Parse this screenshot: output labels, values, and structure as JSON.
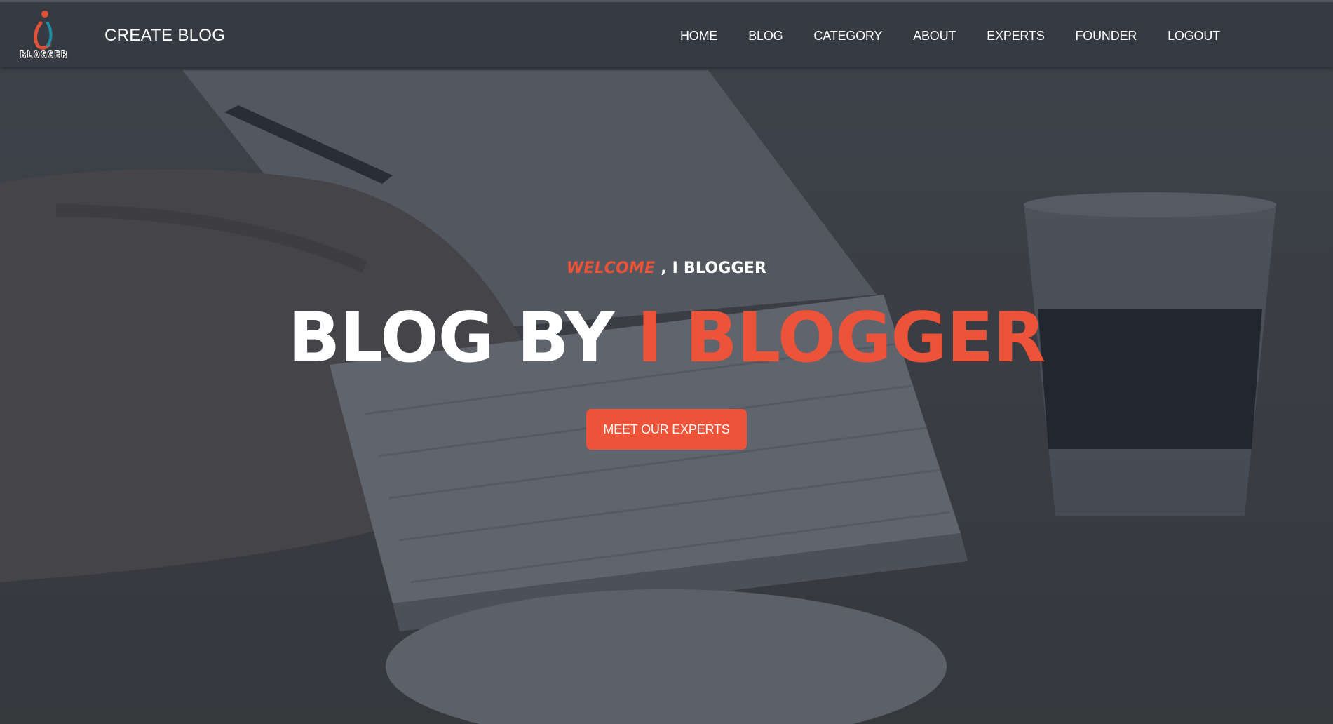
{
  "navbar": {
    "logo_text": "BLOGGER",
    "brand": "CREATE BLOG",
    "links": [
      "HOME",
      "BLOG",
      "CATEGORY",
      "ABOUT",
      "EXPERTS",
      "FOUNDER",
      "LOGOUT"
    ]
  },
  "hero": {
    "welcome_accent": "WELCOME",
    "welcome_rest": " , I BLOGGER",
    "headline_main": "BLOG BY ",
    "headline_accent": "I BLOGGER",
    "cta_label": "MEET OUR EXPERTS"
  },
  "colors": {
    "accent": "#ed5338",
    "navbar_bg": "#363b43",
    "text": "#ffffff"
  }
}
